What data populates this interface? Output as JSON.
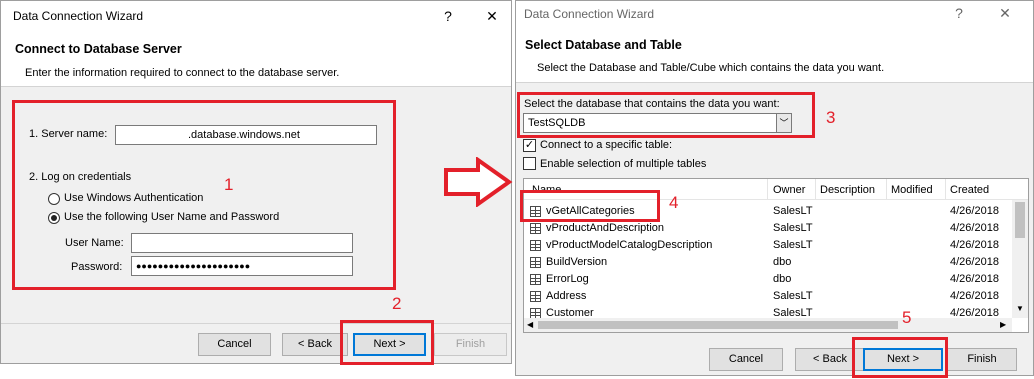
{
  "left_dialog": {
    "title": "Data Connection Wizard",
    "help": "?",
    "close": "✕",
    "heading": "Connect to Database Server",
    "subheading": "Enter the information required to connect to the database server.",
    "server_label": "1. Server name:",
    "server_value": ".database.windows.net",
    "logon_label": "2. Log on credentials",
    "opt_windows": "Use Windows Authentication",
    "opt_userpass": "Use the following User Name and Password",
    "username_label": "User Name:",
    "username_value": "",
    "password_label": "Password:",
    "password_value": "●●●●●●●●●●●●●●●●●●●●●",
    "btn_cancel": "Cancel",
    "btn_back": "< Back",
    "btn_next": "Next >",
    "btn_finish": "Finish"
  },
  "right_dialog": {
    "title": "Data Connection Wizard",
    "help": "?",
    "close": "✕",
    "heading": "Select Database and Table",
    "subheading": "Select the Database and Table/Cube which contains the data you want.",
    "db_label": "Select the database that contains the data you want:",
    "db_value": "TestSQLDB",
    "chk_specific": "Connect to a specific table:",
    "chk_multiple": "Enable selection of multiple tables",
    "columns": [
      "Name",
      "Owner",
      "Description",
      "Modified",
      "Created"
    ],
    "rows": [
      {
        "name": "vGetAllCategories",
        "owner": "SalesLT",
        "created": "4/26/2018"
      },
      {
        "name": "vProductAndDescription",
        "owner": "SalesLT",
        "created": "4/26/2018"
      },
      {
        "name": "vProductModelCatalogDescription",
        "owner": "SalesLT",
        "created": "4/26/2018"
      },
      {
        "name": "BuildVersion",
        "owner": "dbo",
        "created": "4/26/2018"
      },
      {
        "name": "ErrorLog",
        "owner": "dbo",
        "created": "4/26/2018"
      },
      {
        "name": "Address",
        "owner": "SalesLT",
        "created": "4/26/2018"
      },
      {
        "name": "Customer",
        "owner": "SalesLT",
        "created": "4/26/2018"
      }
    ],
    "btn_cancel": "Cancel",
    "btn_back": "< Back",
    "btn_next": "Next >",
    "btn_finish": "Finish"
  },
  "annotations": {
    "step1": "1",
    "step2": "2",
    "step3": "3",
    "step4": "4",
    "step5": "5",
    "color": "#e3202a"
  }
}
